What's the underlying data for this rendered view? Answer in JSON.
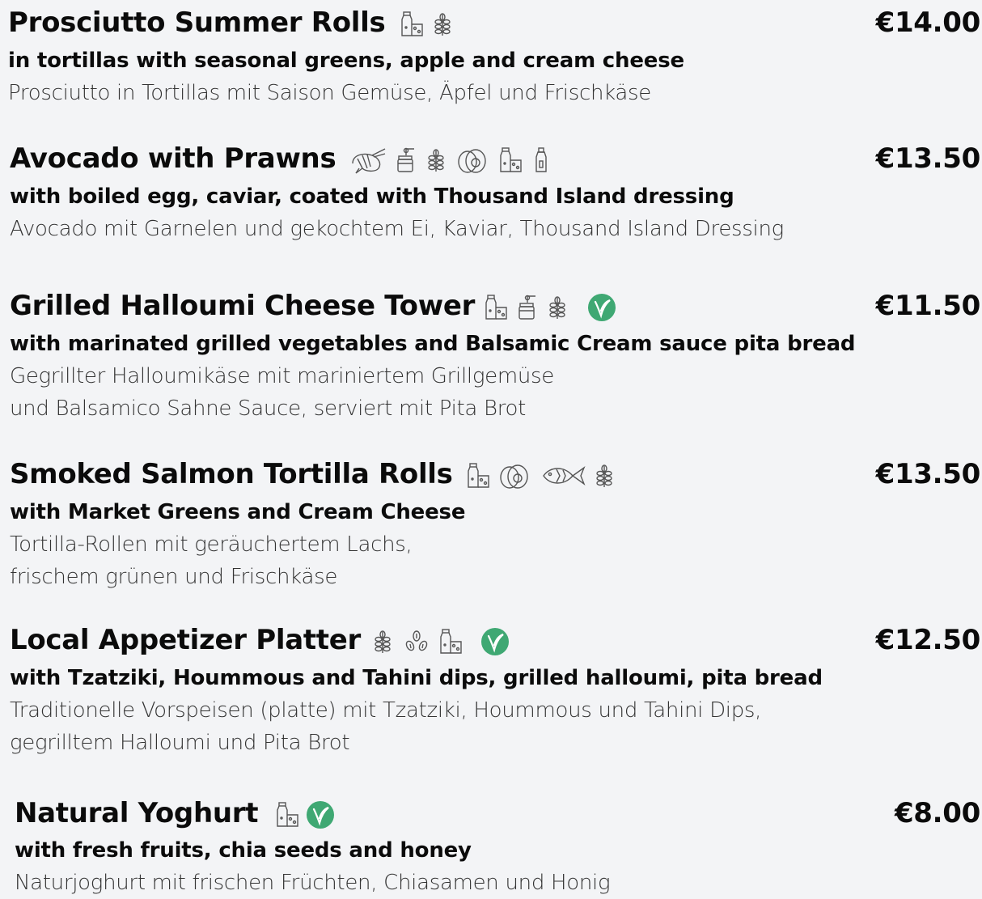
{
  "items": [
    {
      "name": "Prosciutto Summer Rolls",
      "price": "€14.00",
      "sub": "in tortillas with seasonal greens, apple and cream cheese",
      "de": [
        "Prosciutto in Tortillas mit Saison Gemüse, Äpfel und Frischkäse"
      ],
      "icons": [
        "milk-icon",
        "gluten-icon"
      ]
    },
    {
      "name": "Avocado with Prawns",
      "price": "€13.50",
      "sub": "with boiled egg, caviar, coated with Thousand Island dressing",
      "de": [
        "Avocado mit Garnelen und gekochtem Ei, Kaviar, Thousand Island Dressing"
      ],
      "icons": [
        "shrimp-icon",
        "mustard-icon",
        "gluten-icon",
        "egg-icon",
        "milk-icon",
        "sauce-bottle-icon"
      ]
    },
    {
      "name": "Grilled Halloumi Cheese Tower",
      "price": "€11.50",
      "sub": "with marinated grilled vegetables and Balsamic Cream sauce pita bread",
      "de": [
        "Gegrillter Halloumikäse mit mariniertem Grillgemüse",
        "und Balsamico Sahne Sauce, serviert mit Pita Brot"
      ],
      "icons": [
        "milk-icon",
        "mustard-icon",
        "gluten-icon",
        "vegetarian-icon"
      ]
    },
    {
      "name": "Smoked Salmon Tortilla Rolls",
      "price": "€13.50",
      "sub": "with Market Greens and Cream Cheese",
      "de": [
        "Tortilla-Rollen mit geräuchertem Lachs,",
        "frischem grünen und Frischkäse"
      ],
      "icons": [
        "milk-icon",
        "egg-icon",
        "fish-icon",
        "gluten-icon"
      ]
    },
    {
      "name": "Local Appetizer Platter",
      "price": "€12.50",
      "sub": "with Tzatziki, Hoummous and Tahini dips, grilled halloumi, pita bread",
      "de": [
        "Traditionelle Vorspeisen (platte) mit Tzatziki, Hoummous und Tahini Dips,",
        "gegrilltem Halloumi und Pita Brot"
      ],
      "icons": [
        "gluten-icon",
        "sesame-icon",
        "milk-icon",
        "vegetarian-icon"
      ]
    },
    {
      "name": "Natural Yoghurt",
      "price": "€8.00",
      "sub": "with fresh fruits, chia seeds and honey",
      "de": [
        "Naturjoghurt mit frischen Früchten, Chiasamen und Honig"
      ],
      "icons": [
        "milk-icon",
        "vegetarian-icon"
      ]
    }
  ],
  "colors": {
    "vegetarian": "#3fa873",
    "icon_stroke": "#555555",
    "text": "#0b0b0b"
  }
}
